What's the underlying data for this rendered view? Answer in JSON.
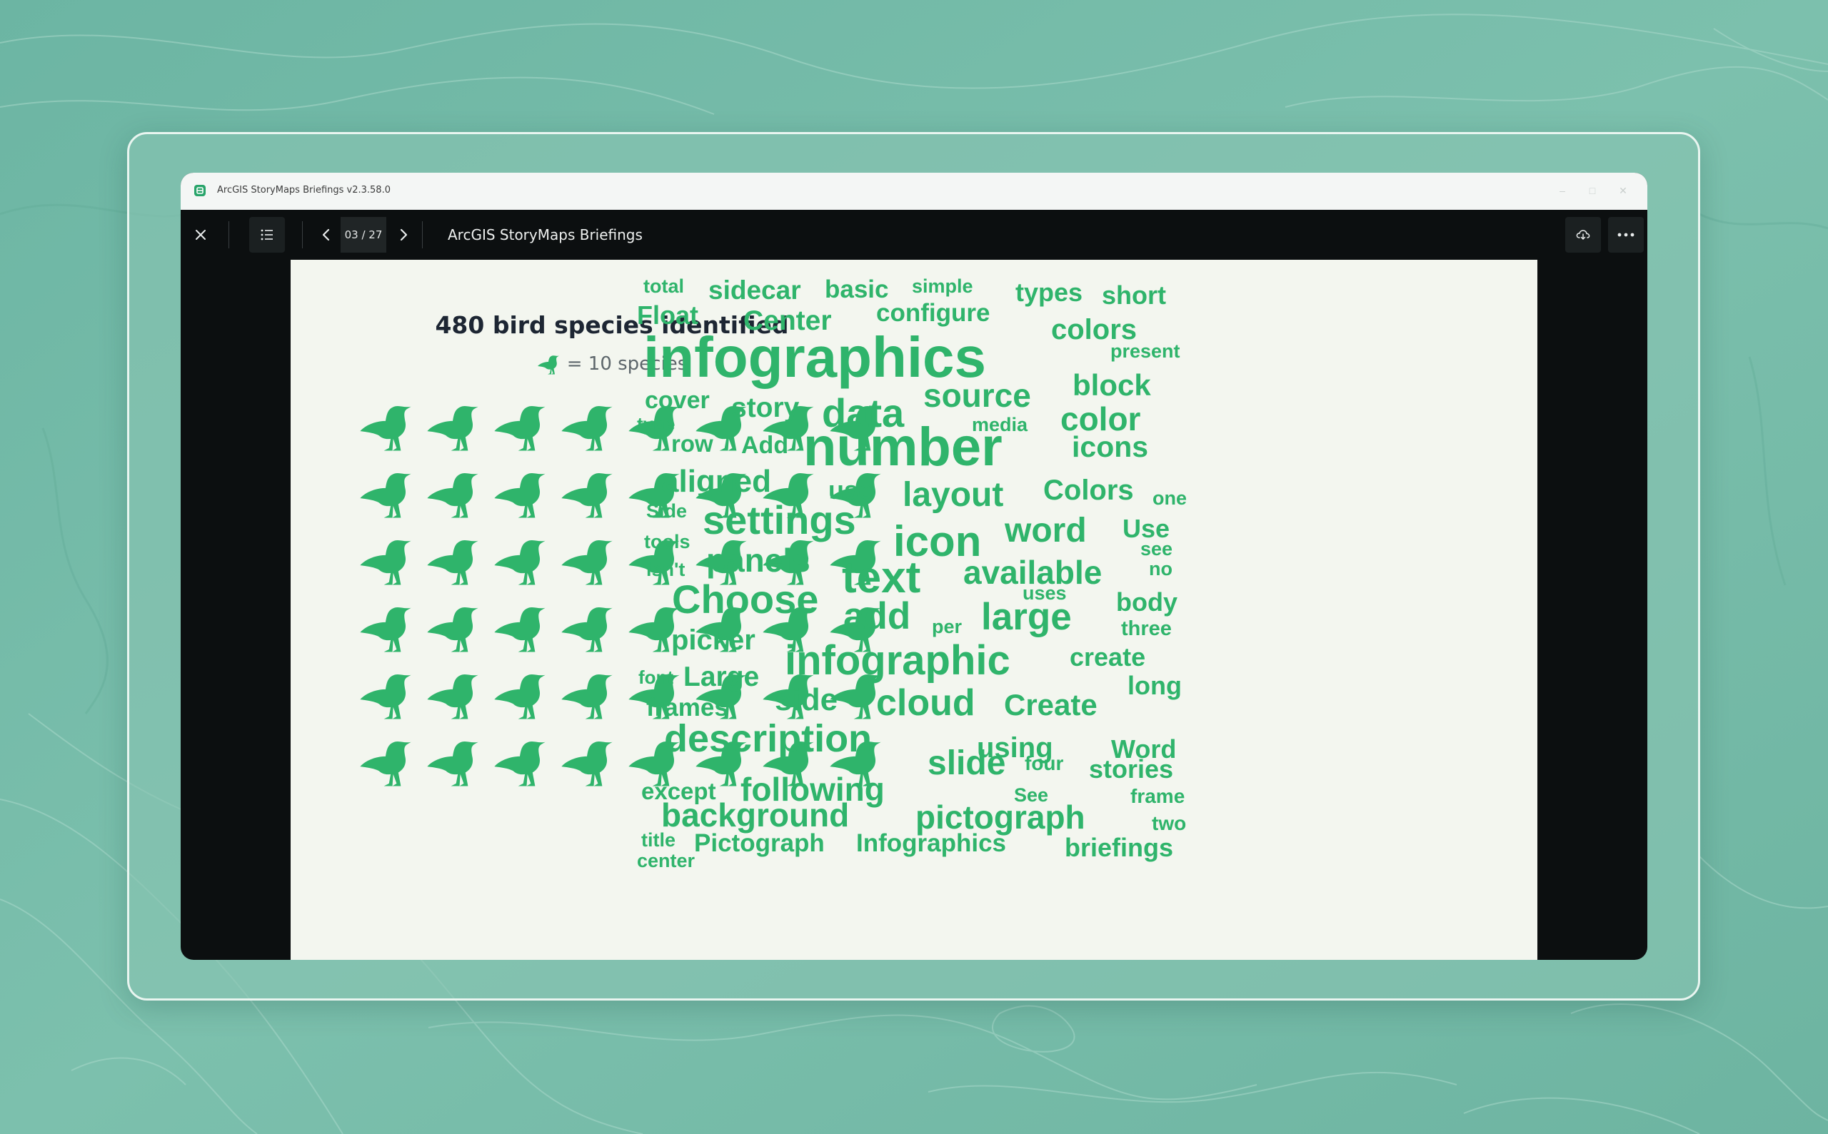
{
  "app": {
    "window_title": "ArcGIS StoryMaps Briefings v2.3.58.0",
    "doc_title": "ArcGIS StoryMaps Briefings",
    "page_counter": "03 / 27"
  },
  "icons": {
    "close": "close-icon",
    "list": "list-icon",
    "prev": "chevron-left-icon",
    "next": "chevron-right-icon",
    "download": "cloud-download-icon",
    "more": "more-horizontal-icon",
    "bird": "bird-icon"
  },
  "colors": {
    "accent": "#2fb46b",
    "slide_bg": "#f3f6ef",
    "toolbar_bg": "#0c0f10"
  },
  "slide": {
    "pictograph": {
      "title": "480 bird species identified",
      "legend_text": "= 10 species",
      "unit_value": 10,
      "icon_count": 48
    },
    "wordcloud": [
      {
        "text": "total",
        "weight": 1
      },
      {
        "text": "sidecar",
        "weight": 2
      },
      {
        "text": "basic",
        "weight": 2
      },
      {
        "text": "simple",
        "weight": 1
      },
      {
        "text": "types",
        "weight": 2
      },
      {
        "text": "short",
        "weight": 2
      },
      {
        "text": "Float",
        "weight": 2
      },
      {
        "text": "Center",
        "weight": 2
      },
      {
        "text": "configure",
        "weight": 2
      },
      {
        "text": "colors",
        "weight": 2
      },
      {
        "text": "infographics",
        "weight": 5
      },
      {
        "text": "present",
        "weight": 1
      },
      {
        "text": "cover",
        "weight": 2
      },
      {
        "text": "story",
        "weight": 2
      },
      {
        "text": "source",
        "weight": 3
      },
      {
        "text": "block",
        "weight": 2
      },
      {
        "text": "type",
        "weight": 1
      },
      {
        "text": "data",
        "weight": 3
      },
      {
        "text": "media",
        "weight": 1
      },
      {
        "text": "color",
        "weight": 3
      },
      {
        "text": "row",
        "weight": 2
      },
      {
        "text": "Add",
        "weight": 2
      },
      {
        "text": "number",
        "weight": 5
      },
      {
        "text": "icons",
        "weight": 2
      },
      {
        "text": "aligned",
        "weight": 3
      },
      {
        "text": "use",
        "weight": 2
      },
      {
        "text": "layout",
        "weight": 3
      },
      {
        "text": "Colors",
        "weight": 2
      },
      {
        "text": "one",
        "weight": 1
      },
      {
        "text": "Side",
        "weight": 1
      },
      {
        "text": "settings",
        "weight": 3
      },
      {
        "text": "word",
        "weight": 3
      },
      {
        "text": "Use",
        "weight": 2
      },
      {
        "text": "tools",
        "weight": 1
      },
      {
        "text": "icon",
        "weight": 4
      },
      {
        "text": "see",
        "weight": 1
      },
      {
        "text": "panels",
        "weight": 3
      },
      {
        "text": "isn't",
        "weight": 1
      },
      {
        "text": "text",
        "weight": 4
      },
      {
        "text": "available",
        "weight": 3
      },
      {
        "text": "no",
        "weight": 1
      },
      {
        "text": "Choose",
        "weight": 3
      },
      {
        "text": "uses",
        "weight": 1
      },
      {
        "text": "body",
        "weight": 2
      },
      {
        "text": "add",
        "weight": 3
      },
      {
        "text": "per",
        "weight": 1
      },
      {
        "text": "large",
        "weight": 3
      },
      {
        "text": "three",
        "weight": 1
      },
      {
        "text": "picker",
        "weight": 2
      },
      {
        "text": "infographic",
        "weight": 4
      },
      {
        "text": "create",
        "weight": 2
      },
      {
        "text": "font",
        "weight": 1
      },
      {
        "text": "Large",
        "weight": 2
      },
      {
        "text": "long",
        "weight": 2
      },
      {
        "text": "frames",
        "weight": 2
      },
      {
        "text": "side",
        "weight": 3
      },
      {
        "text": "cloud",
        "weight": 3
      },
      {
        "text": "Create",
        "weight": 2
      },
      {
        "text": "description",
        "weight": 3
      },
      {
        "text": "using",
        "weight": 2
      },
      {
        "text": "Word",
        "weight": 2
      },
      {
        "text": "slide",
        "weight": 3
      },
      {
        "text": "four",
        "weight": 1
      },
      {
        "text": "stories",
        "weight": 2
      },
      {
        "text": "except",
        "weight": 2
      },
      {
        "text": "following",
        "weight": 3
      },
      {
        "text": "See",
        "weight": 1
      },
      {
        "text": "frame",
        "weight": 1
      },
      {
        "text": "background",
        "weight": 3
      },
      {
        "text": "pictograph",
        "weight": 3
      },
      {
        "text": "two",
        "weight": 1
      },
      {
        "text": "title",
        "weight": 1
      },
      {
        "text": "Pictograph",
        "weight": 2
      },
      {
        "text": "Infographics",
        "weight": 2
      },
      {
        "text": "briefings",
        "weight": 2
      },
      {
        "text": "center",
        "weight": 1
      }
    ]
  }
}
